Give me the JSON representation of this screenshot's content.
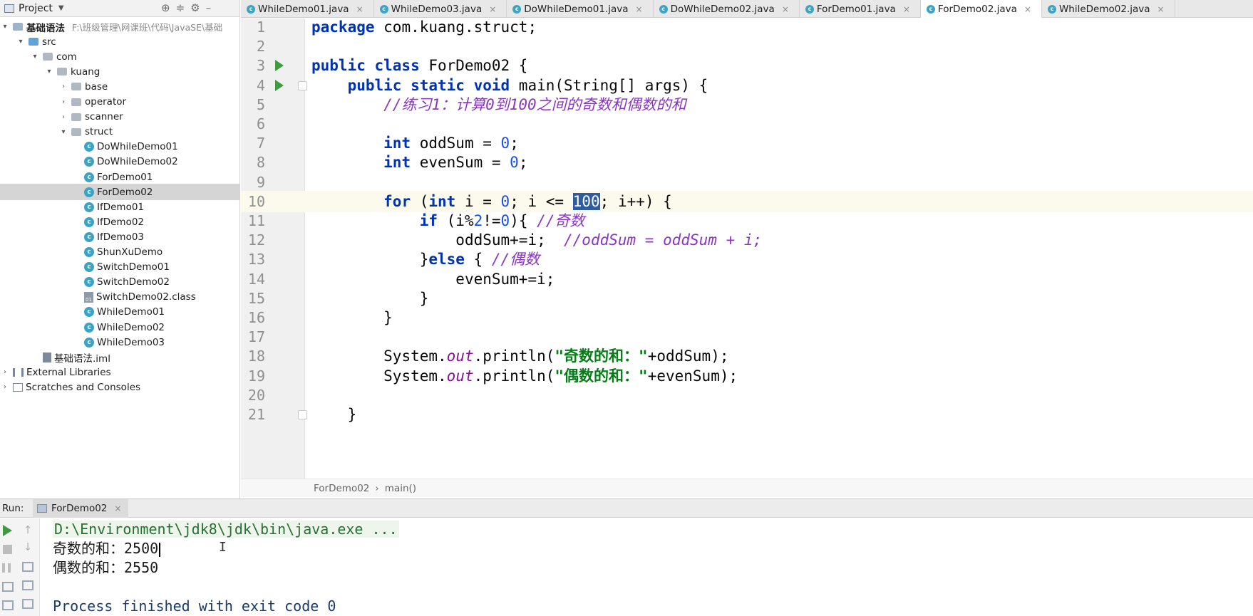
{
  "project_panel": {
    "title": "Project",
    "root_label": "基础语法",
    "root_path": "F:\\班级管理\\网课班\\代码\\JavaSE\\基础",
    "tree": [
      {
        "label": "src",
        "level": 1,
        "type": "src"
      },
      {
        "label": "com",
        "level": 2,
        "type": "package"
      },
      {
        "label": "kuang",
        "level": 3,
        "type": "package"
      },
      {
        "label": "base",
        "level": 4,
        "type": "package",
        "collapsed": true
      },
      {
        "label": "operator",
        "level": 4,
        "type": "package",
        "collapsed": true
      },
      {
        "label": "scanner",
        "level": 4,
        "type": "package",
        "collapsed": true
      },
      {
        "label": "struct",
        "level": 4,
        "type": "package"
      },
      {
        "label": "DoWhileDemo01",
        "level": 5,
        "type": "class"
      },
      {
        "label": "DoWhileDemo02",
        "level": 5,
        "type": "class"
      },
      {
        "label": "ForDemo01",
        "level": 5,
        "type": "class"
      },
      {
        "label": "ForDemo02",
        "level": 5,
        "type": "class",
        "selected": true
      },
      {
        "label": "IfDemo01",
        "level": 5,
        "type": "class"
      },
      {
        "label": "IfDemo02",
        "level": 5,
        "type": "class"
      },
      {
        "label": "IfDemo03",
        "level": 5,
        "type": "class"
      },
      {
        "label": "ShunXuDemo",
        "level": 5,
        "type": "class"
      },
      {
        "label": "SwitchDemo01",
        "level": 5,
        "type": "class"
      },
      {
        "label": "SwitchDemo02",
        "level": 5,
        "type": "class"
      },
      {
        "label": "SwitchDemo02.class",
        "level": 5,
        "type": "classfile"
      },
      {
        "label": "WhileDemo01",
        "level": 5,
        "type": "class"
      },
      {
        "label": "WhileDemo02",
        "level": 5,
        "type": "class"
      },
      {
        "label": "WhileDemo03",
        "level": 5,
        "type": "class"
      },
      {
        "label": "基础语法.iml",
        "level": 2,
        "type": "iml"
      },
      {
        "label": "External Libraries",
        "level": 0,
        "type": "libs"
      },
      {
        "label": "Scratches and Consoles",
        "level": 0,
        "type": "scratch"
      }
    ]
  },
  "tabs": [
    {
      "label": "WhileDemo01.java",
      "active": false
    },
    {
      "label": "WhileDemo03.java",
      "active": false
    },
    {
      "label": "DoWhileDemo01.java",
      "active": false
    },
    {
      "label": "DoWhileDemo02.java",
      "active": false
    },
    {
      "label": "ForDemo01.java",
      "active": false
    },
    {
      "label": "ForDemo02.java",
      "active": true
    },
    {
      "label": "WhileDemo02.java",
      "active": false
    }
  ],
  "editor": {
    "line_numbers": [
      "1",
      "2",
      "3",
      "4",
      "5",
      "6",
      "7",
      "8",
      "9",
      "10",
      "11",
      "12",
      "13",
      "14",
      "15",
      "16",
      "17",
      "18",
      "19",
      "20",
      "21"
    ],
    "current_line": "10",
    "code": {
      "l1_kw": "package",
      "l1_rest": " com.kuang.struct;",
      "l3_kw": "public class",
      "l3_rest": " ForDemo02 {",
      "l4_kw": "public static void",
      "l4_rest": " main(String[] args) {",
      "l5_comment": "//练习1：计算0到100之间的奇数和偶数的和",
      "l7_kw": "int",
      "l7_a": " oddSum = ",
      "l7_num": "0",
      "l7_b": ";",
      "l8_kw": "int",
      "l8_a": " evenSum = ",
      "l8_num": "0",
      "l8_b": ";",
      "l10_kw1": "for",
      "l10_a": " (",
      "l10_kw2": "int",
      "l10_b": " i = ",
      "l10_num1": "0",
      "l10_c": "; i <= ",
      "l10_sel": "100",
      "l10_d": "; i++) {",
      "l11_kw": "if",
      "l11_a": " (i%",
      "l11_num1": "2",
      "l11_b": "!=",
      "l11_num2": "0",
      "l11_c": "){ ",
      "l11_comment": "//奇数",
      "l12_a": "oddSum+=i;  ",
      "l12_comment": "//oddSum = oddSum + i;",
      "l13_a": "}",
      "l13_kw": "else",
      "l13_b": " { ",
      "l13_comment": "//偶数",
      "l14_a": "evenSum+=i;",
      "l15_a": "}",
      "l16_a": "}",
      "l18_a": "System.",
      "l18_static": "out",
      "l18_b": ".println(",
      "l18_str": "\"奇数的和：\"",
      "l18_c": "+oddSum);",
      "l19_a": "System.",
      "l19_static": "out",
      "l19_b": ".println(",
      "l19_str": "\"偶数的和：\"",
      "l19_c": "+evenSum);",
      "l21_a": "}"
    }
  },
  "breadcrumb": [
    "ForDemo02",
    "main()"
  ],
  "run_panel": {
    "label": "Run:",
    "tab_label": "ForDemo02",
    "console": {
      "command": "D:\\Environment\\jdk8\\jdk\\bin\\java.exe ...",
      "out1_label": "奇数的和：",
      "out1_value": "2500",
      "out2_label": "偶数的和：",
      "out2_value": "2550",
      "finished": "Process finished with exit code 0"
    }
  },
  "colors": {
    "keyword": "#0033b3",
    "number": "#1750eb",
    "comment": "#8c35c5",
    "string": "#067d17",
    "selection": "#2d5c9f",
    "run_green": "#3f9b3f"
  }
}
